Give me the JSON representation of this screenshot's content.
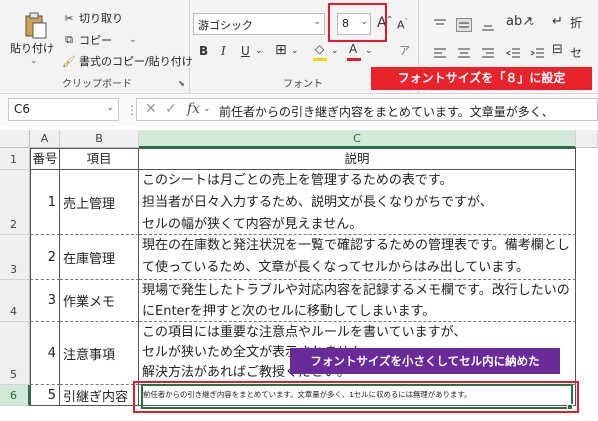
{
  "ribbon": {
    "clipboard": {
      "paste_label": "貼り付け",
      "cut_label": "切り取り",
      "copy_label": "コピー",
      "format_painter_label": "書式のコピー/貼り付け",
      "group_label": "クリップボード"
    },
    "font": {
      "font_name": "游ゴシック",
      "font_size": "8",
      "group_label": "フォント"
    },
    "alignment": {
      "wrap_label": "折",
      "merge_label": "セ"
    }
  },
  "annotations": {
    "font_size_note": "フォントサイズを「８」に設定",
    "shrink_note": "フォントサイズを小さくしてセル内に納めた"
  },
  "formula_bar": {
    "name_box": "C6",
    "formula_text": "前任者からの引き継ぎ内容をまとめています。文章量が多く、"
  },
  "sheet": {
    "columns": [
      "A",
      "B",
      "C"
    ],
    "rows": [
      "1",
      "2",
      "3",
      "4",
      "5",
      "6"
    ],
    "headers": [
      "番号",
      "項目",
      "説明"
    ],
    "data": [
      {
        "number": "1",
        "item": "売上管理",
        "lines": [
          "このシートは月ごとの売上を管理するための表です。",
          "担当者が日々入力するため、説明文が長くなりがちですが、",
          "セルの幅が狭くて内容が見えません。"
        ]
      },
      {
        "number": "2",
        "item": "在庫管理",
        "lines": [
          "現在の在庫数と発注状況を一覧で確認するための管理表です。備考欄とし",
          "て使っているため、文章が長くなってセルからはみ出しています。"
        ]
      },
      {
        "number": "3",
        "item": "作業メモ",
        "lines": [
          "現場で発生したトラブルや対応内容を記録するメモ欄です。改行したいの",
          "にEnterを押すと次のセルに移動してしまいます。"
        ]
      },
      {
        "number": "4",
        "item": "注意事項",
        "lines": [
          "この項目には重要な注意点やルールを書いていますが、",
          "セルが狭いため全文が表示されません。",
          "解決方法があればご教授ください。"
        ]
      },
      {
        "number": "5",
        "item": "引継ぎ内容",
        "lines": [
          "前任者からの引き継ぎ内容をまとめています。文章量が多く、1セルに収めるには無理があります。"
        ]
      }
    ]
  }
}
